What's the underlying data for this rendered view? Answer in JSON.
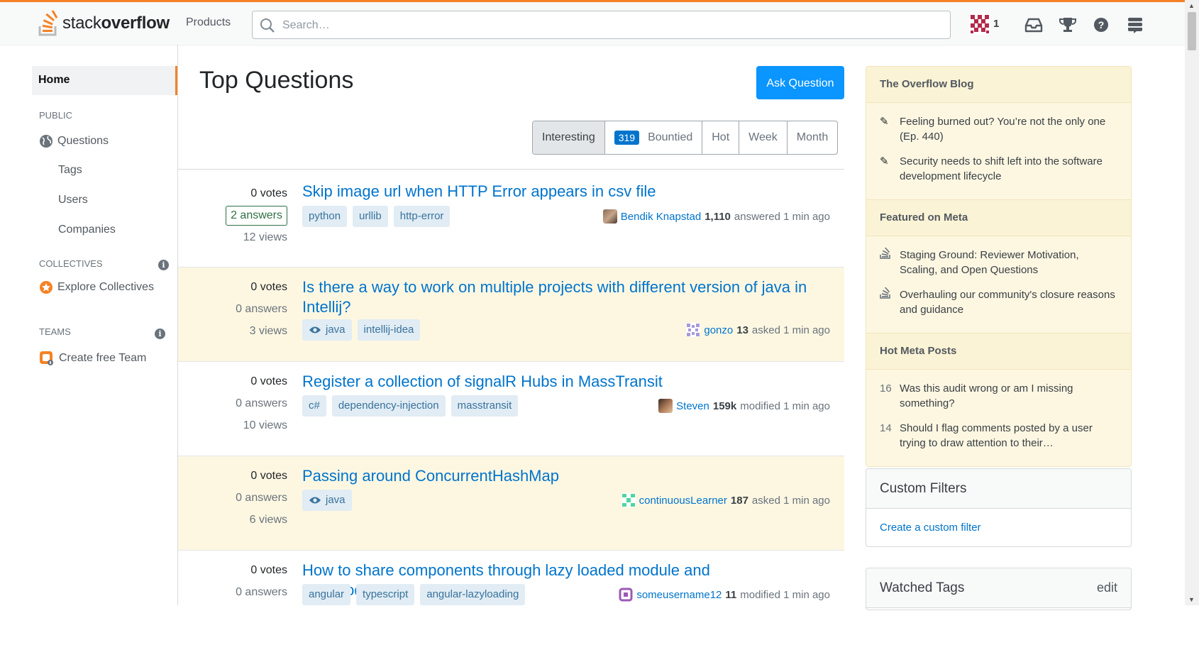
{
  "header": {
    "logo_light": "stack",
    "logo_bold": "overflow",
    "products": "Products",
    "search_placeholder": "Search…",
    "reputation": "1"
  },
  "sidebar": {
    "home": "Home",
    "public_label": "PUBLIC",
    "items": [
      "Questions",
      "Tags",
      "Users",
      "Companies"
    ],
    "collectives_label": "COLLECTIVES",
    "explore_collectives": "Explore Collectives",
    "teams_label": "TEAMS",
    "create_team": "Create free Team",
    "info": "i"
  },
  "main": {
    "title": "Top Questions",
    "ask_button": "Ask Question",
    "filters": {
      "interesting": "Interesting",
      "bounty_count": "319",
      "bountied": "Bountied",
      "hot": "Hot",
      "week": "Week",
      "month": "Month"
    }
  },
  "questions": [
    {
      "votes": "0 votes",
      "answers": "2 answers",
      "views": "12 views",
      "title": "Skip image url when HTTP Error appears in csv file",
      "tags": [
        "python",
        "urllib",
        "http-error"
      ],
      "user": "Bendik Knapstad",
      "rep": "1,110",
      "action": "answered 1 min ago"
    },
    {
      "votes": "0 votes",
      "answers": "0 answers",
      "views": "3 views",
      "title": "Is there a way to work on multiple projects with different version of java in Intellij?",
      "tags": [
        "java",
        "intellij-idea"
      ],
      "user": "gonzo",
      "rep": "13",
      "action": "asked 1 min ago"
    },
    {
      "votes": "0 votes",
      "answers": "0 answers",
      "views": "10 views",
      "title": "Register a collection of signalR Hubs in MassTransit",
      "tags": [
        "c#",
        "dependency-injection",
        "masstransit"
      ],
      "user": "Steven",
      "rep": "159k",
      "action": "modified 1 min ago"
    },
    {
      "votes": "0 votes",
      "answers": "0 answers",
      "views": "6 views",
      "title": "Passing around ConcurrentHashMap",
      "tags": [
        "java"
      ],
      "user": "continuousLearner",
      "rep": "187",
      "action": "asked 1 min ago"
    },
    {
      "votes": "0 votes",
      "answers": "0 answers",
      "views": "",
      "title": "How to share components through lazy loaded module and app.module.ts?",
      "tags": [
        "angular",
        "typescript",
        "angular-lazyloading"
      ],
      "user": "someusername12",
      "rep": "11",
      "action": "modified 1 min ago"
    }
  ],
  "right": {
    "blog_title": "The Overflow Blog",
    "blog_items": [
      "Feeling burned out? You’re not the only one (Ep. 440)",
      "Security needs to shift left into the software development lifecycle"
    ],
    "meta_title": "Featured on Meta",
    "meta_items": [
      "Staging Ground: Reviewer Motivation, Scaling, and Open Questions",
      "Overhauling our community's closure reasons and guidance"
    ],
    "hot_title": "Hot Meta Posts",
    "hot_items": [
      {
        "count": "16",
        "text": "Was this audit wrong or am I missing something?"
      },
      {
        "count": "14",
        "text": "Should I flag comments posted by a user trying to draw attention to their…"
      }
    ],
    "custom_filters_title": "Custom Filters",
    "custom_filter_link": "Create a custom filter",
    "watched_tags_title": "Watched Tags",
    "watched_tags_edit": "edit"
  },
  "colors": {
    "accent": "#f48225",
    "link": "#0074cc",
    "button": "#0a95ff",
    "watched_bg": "#fdf7e2"
  }
}
